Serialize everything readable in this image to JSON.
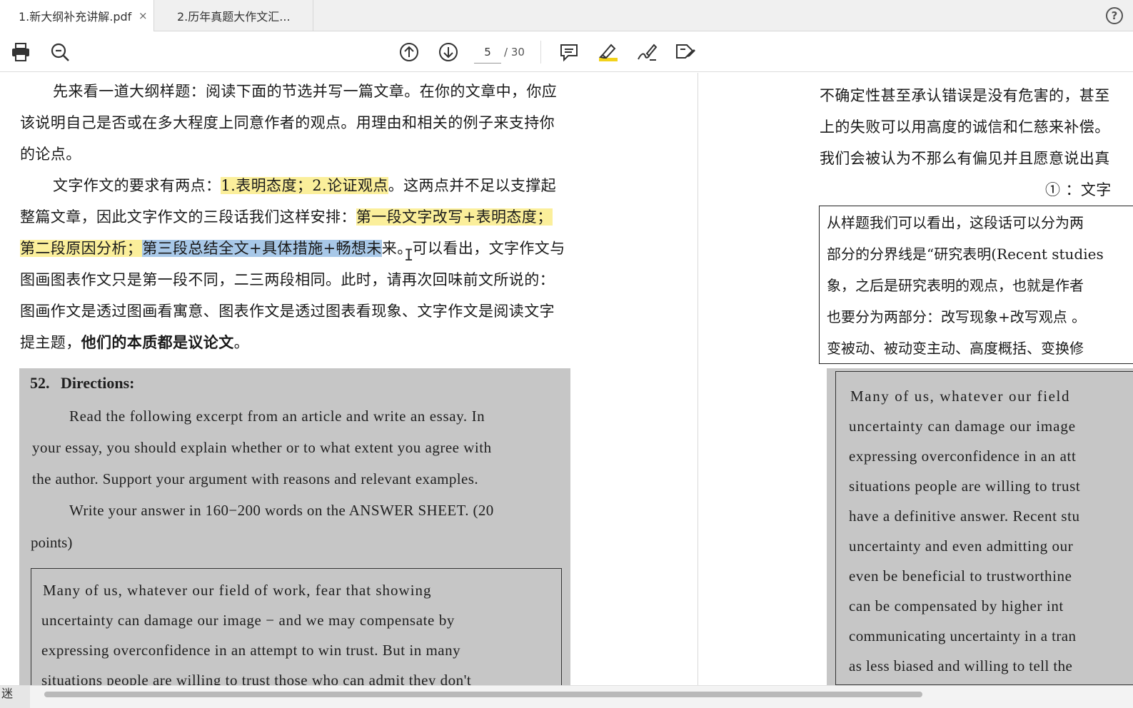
{
  "tabs": [
    {
      "label": "1.新大纲补充讲解.pdf",
      "close": "×",
      "active": true
    },
    {
      "label": "2.历年真题大作文汇...",
      "active": false
    }
  ],
  "toolbar": {
    "print_icon": "printer-icon",
    "zoom_icon": "zoom-out-icon",
    "prev_icon": "arrow-up-circle-icon",
    "next_icon": "arrow-down-circle-icon",
    "current_page": "5",
    "total_pages": "/ 30",
    "comment_icon": "comment-icon",
    "highlight_icon": "highlighter-icon",
    "sign_icon": "signature-icon",
    "edit_icon": "edit-tag-icon",
    "help": "?"
  },
  "left_page": {
    "para1": {
      "l1": "先来看一道大纲样题：阅读下面的节选并写一篇文章。在你的文章中，你应",
      "l2": "该说明自己是否或在多大程度上同意作者的观点。用理由和相关的例子来支持你",
      "l3": "的论点。"
    },
    "para2": {
      "l1_a": "文字作文的要求有两点：",
      "l1_hl": "1.表明态度；2.论证观点",
      "l1_b": "。这两点并不足以支撑起",
      "l2_a": "整篇文章，因此文字作文的三段话我们这样安排：",
      "l2_hl": "第一段文字改写+表明态度；",
      "l3_hl_y": "第二段原因分析；",
      "l3_hl_b": "第三段总结全文+具体措施+畅想未",
      "l3_b": "来。可以看出，文字作文与",
      "l4": "图画图表作文只是第一段不同，二三两段相同。此时，请再次回味前文所说的：",
      "l5": "图画作文是透过图画看寓意、图表作文是透过图表看现象、文字作文是阅读文字",
      "l6_a": "提主题，",
      "l6_bold": "他们的本质都是议论文",
      "l6_b": "。"
    },
    "scan": {
      "heading_num": "52.",
      "heading": "Directions:",
      "d1": "Read the following excerpt from an article and write an essay. In",
      "d2": "your essay, you should explain whether or to what extent you agree with",
      "d3": "the author. Support your argument with reasons and relevant examples.",
      "d4": "Write your answer in 160−200 words on the ANSWER SHEET. (20",
      "d5": "points)",
      "b1": "Many of us, whatever our field of work, fear that showing",
      "b2": "uncertainty can damage our image − and we may compensate by",
      "b3": "expressing overconfidence in an attempt to win trust. But in many",
      "b4": "situations people are willing to trust those who can admit they don't"
    }
  },
  "right_page": {
    "l1": "不确定性甚至承认错误是没有危害的，甚至",
    "l2": "上的失败可以用高度的诚信和仁慈来补偿。",
    "l3": "我们会被认为不那么有偏见并且愿意说出真",
    "l4": "① ：文字",
    "box": {
      "l1": "从样题我们可以看出，这段话可以分为两",
      "l2": "部分的分界线是“研究表明(Recent studies",
      "l3": "象，之后是研究表明的观点，也就是作者",
      "l4": "也要分为两部分：改写现象+改写观点 。",
      "l5": "变被动、被动变主动、高度概括、变换修"
    },
    "scan": {
      "r1": "Many of us, whatever our field",
      "r2": "uncertainty can damage our image",
      "r3": "expressing overconfidence in an att",
      "r4": "situations people are willing to trust",
      "r5": "have a definitive answer. Recent stu",
      "r6": "uncertainty and even admitting our",
      "r7": "even be beneficial to trustworthine",
      "r8": "can be compensated by higher int",
      "r9": "communicating uncertainty in a tran",
      "r10": "as less biased and willing to tell the"
    }
  },
  "statusbar": {
    "left_text": "迷"
  },
  "colors": {
    "highlight_yellow": "#fbef9b",
    "highlight_blue": "#a8c8e8",
    "highlighter_tool": "#f2d21b"
  }
}
